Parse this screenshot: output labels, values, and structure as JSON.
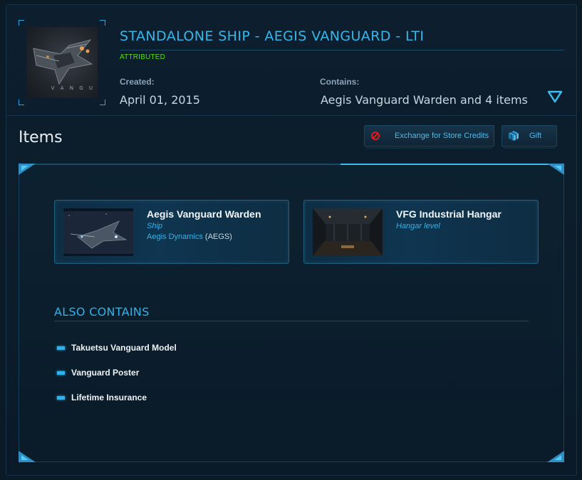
{
  "pledge": {
    "title": "STANDALONE SHIP - AEGIS VANGUARD - LTI",
    "status": "ATTRIBUTED",
    "thumbnail_caption": "V A N G U",
    "created_label": "Created:",
    "created_value": "April 01, 2015",
    "contains_label": "Contains:",
    "contains_value": "Aegis Vanguard Warden and 4 items"
  },
  "items_section": {
    "heading": "Items",
    "exchange_label": "Exchange for Store Credits",
    "gift_label": "Gift"
  },
  "items": [
    {
      "name": "Aegis Vanguard Warden",
      "type": "Ship",
      "manufacturer": "Aegis Dynamics",
      "manufacturer_code": "(AEGS)"
    },
    {
      "name": "VFG Industrial Hangar",
      "type": "Hangar level"
    }
  ],
  "also_contains": {
    "heading": "ALSO CONTAINS",
    "items": [
      "Takuetsu Vanguard Model",
      "Vanguard Poster",
      "Lifetime Insurance"
    ]
  },
  "colors": {
    "accent": "#38b6ea",
    "attributed": "#52e010",
    "background": "#0b1a27"
  },
  "icons": [
    "expand-triangle-icon",
    "prohibited-icon",
    "gift-cube-icon"
  ]
}
